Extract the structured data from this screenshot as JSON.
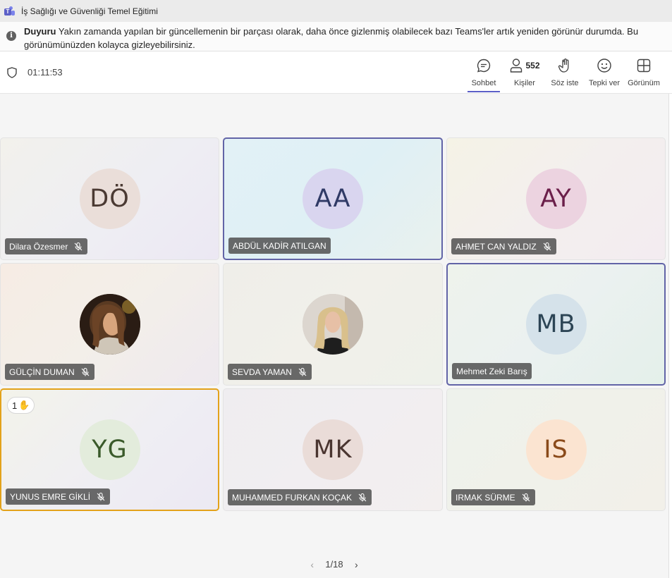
{
  "window": {
    "title": "İş Sağlığı ve Güvenliği Temel Eğitimi"
  },
  "banner": {
    "label": "Duyuru",
    "text": " Yakın zamanda yapılan bir güncellemenin bir parçası olarak, daha önce gizlenmiş olabilecek bazı Teams'ler artık yeniden görünür durumda. Bu",
    "text_line2": "görünümünüzden kolayca gizleyebilirsiniz."
  },
  "toolbar": {
    "timer": "01:11:53",
    "chat_label": "Sohbet",
    "people_label": "Kişiler",
    "people_count": "552",
    "raise_hand_label": "Söz iste",
    "react_label": "Tepki ver",
    "view_label": "Görünüm"
  },
  "participants": [
    {
      "name": "Dilara Özesmer",
      "initials": "DÖ",
      "muted": true,
      "avatar_bg": "#eaded9",
      "avatar_fg": "#4b3a33"
    },
    {
      "name": "ABDÜL KADİR ATILGAN",
      "initials": "AA",
      "muted": false,
      "speaking": true,
      "avatar_bg": "#d9d5ef",
      "avatar_fg": "#303a66"
    },
    {
      "name": "AHMET CAN YALDIZ",
      "initials": "AY",
      "muted": true,
      "avatar_bg": "#ecd3e0",
      "avatar_fg": "#6b1f4a"
    },
    {
      "name": "GÜLÇİN DUMAN",
      "initials": "",
      "muted": true,
      "photo": true,
      "avatar_bg": "#3a2a22"
    },
    {
      "name": "SEVDA YAMAN",
      "initials": "",
      "muted": true,
      "photo": true,
      "avatar_bg": "#cfc8c2"
    },
    {
      "name": "Mehmet Zeki Barış",
      "initials": "MB",
      "muted": false,
      "speaking": true,
      "avatar_bg": "#d5e2ea",
      "avatar_fg": "#2d4555"
    },
    {
      "name": "YUNUS EMRE GİKLİ",
      "initials": "YG",
      "muted": true,
      "raised_hand": true,
      "hand_count": "1",
      "avatar_bg": "#e3ecdc",
      "avatar_fg": "#3a5a2a"
    },
    {
      "name": "MUHAMMED FURKAN KOÇAK",
      "initials": "MK",
      "muted": true,
      "avatar_bg": "#eadcd8",
      "avatar_fg": "#4a3530"
    },
    {
      "name": "IRMAK SÜRME",
      "initials": "IS",
      "muted": true,
      "avatar_bg": "#fbe4d1",
      "avatar_fg": "#8a4a1a"
    }
  ],
  "pager": {
    "page": "1/18"
  },
  "colors": {
    "accent": "#5b5fc7",
    "speaking_border": "#6264a7",
    "hand_border": "#e3a21a"
  }
}
